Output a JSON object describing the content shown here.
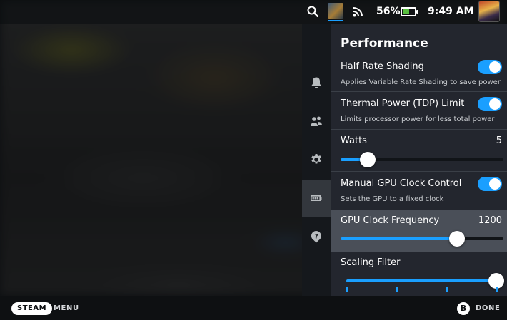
{
  "status_bar": {
    "battery_percent": "56%",
    "battery_level": 0.56,
    "time": "9:49 AM",
    "icons": [
      "search-icon",
      "running-game-icon",
      "wifi-icon",
      "battery-icon",
      "user-avatar"
    ]
  },
  "nav": {
    "items": [
      {
        "name": "notifications",
        "icon": "bell-icon",
        "active": false
      },
      {
        "name": "friends",
        "icon": "friends-icon",
        "active": false
      },
      {
        "name": "settings",
        "icon": "gear-icon",
        "active": false
      },
      {
        "name": "performance",
        "icon": "battery-icon",
        "active": true
      },
      {
        "name": "help",
        "icon": "help-icon",
        "active": false
      }
    ]
  },
  "panel": {
    "title": "Performance",
    "half_rate_shading": {
      "label": "Half Rate Shading",
      "description": "Applies Variable Rate Shading to save power",
      "enabled": true
    },
    "tdp_limit": {
      "label": "Thermal Power (TDP) Limit",
      "description": "Limits processor power for less total power",
      "enabled": true
    },
    "watts": {
      "label": "Watts",
      "value": "5",
      "value_num": 5,
      "min": 3,
      "max": 15
    },
    "gpu_clock_control": {
      "label": "Manual GPU Clock Control",
      "description": "Sets the GPU to a fixed clock",
      "enabled": true
    },
    "gpu_clock_frequency": {
      "label": "GPU Clock Frequency",
      "value": "1200",
      "value_num": 1200,
      "min": 200,
      "max": 1600
    },
    "scaling_filter": {
      "label": "Scaling Filter",
      "level_fraction": 1.0,
      "notch_count": 4
    }
  },
  "bottom_bar": {
    "steam_label": "STEAM",
    "menu_label": "MENU",
    "b_button": "B",
    "done_label": "DONE"
  },
  "colors": {
    "accent": "#1a9fff",
    "panel_bg": "#23262e",
    "focused_row": "#4a4f58",
    "battery_green": "#59bf40"
  }
}
